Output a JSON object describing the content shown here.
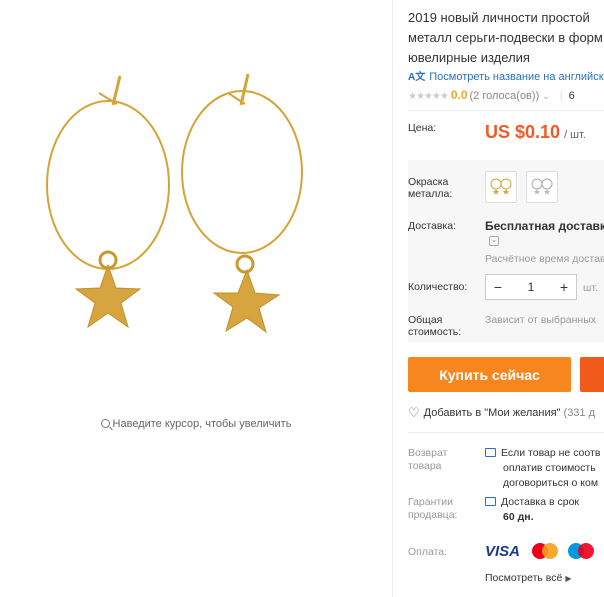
{
  "product": {
    "title_lines": [
      "2019 новый личности простой",
      "металл серьги-подвески в форм",
      "ювелирные изделия"
    ],
    "translate_link": "Посмотреть название на английском",
    "rating_value": "0.0",
    "votes": "(2 голоса(ов))",
    "orders": "6",
    "zoom_hint": "Наведите курсор, чтобы увеличить"
  },
  "price": {
    "label": "Цена:",
    "value": "US $0.10",
    "unit": "/ шт."
  },
  "options": {
    "color_label": "Окраска металла:",
    "swatches": [
      {
        "name": "gold",
        "color": "#d4a437"
      },
      {
        "name": "silver",
        "color": "#bdbdbd"
      }
    ]
  },
  "shipping": {
    "label": "Доставка:",
    "title": "Бесплатная доставка",
    "time": "Расчётное время доставки"
  },
  "quantity": {
    "label": "Количество:",
    "minus": "−",
    "value": "1",
    "plus": "+",
    "unit": "шт."
  },
  "total": {
    "label": "Общая стоимость:",
    "note": "Зависит от выбранных"
  },
  "actions": {
    "buy_now": "Купить сейчас",
    "wishlist": "Добавить в \"Мои желания\"",
    "wish_count": "(331 д"
  },
  "return": {
    "label": "Возврат товара",
    "lines": [
      "Если товар не соотв",
      "оплатив стоимость",
      "договориться о ком"
    ]
  },
  "guarantee": {
    "label": "Гарантии продавца:",
    "line1": "Доставка в срок",
    "line2": "60 дн."
  },
  "payment": {
    "label": "Оплата:",
    "visa": "VISA",
    "see_all": "Посмотреть всё"
  },
  "colors": {
    "accent_orange": "#f7861f",
    "price_red": "#f05a28",
    "link_blue": "#2a6fc4",
    "gold": "#d4a437"
  }
}
